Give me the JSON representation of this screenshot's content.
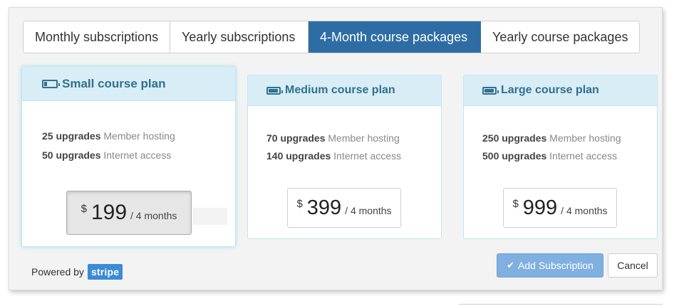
{
  "tabs": [
    {
      "label": "Monthly subscriptions",
      "active": false
    },
    {
      "label": "Yearly subscriptions",
      "active": false
    },
    {
      "label": "4-Month course packages",
      "active": true
    },
    {
      "label": "Yearly course packages",
      "active": false
    }
  ],
  "plans": [
    {
      "name": "Small course plan",
      "selected": true,
      "icon": "battery-low-icon",
      "features": [
        {
          "count": "25 upgrades",
          "label": "Member hosting"
        },
        {
          "count": "50 upgrades",
          "label": "Internet access"
        }
      ],
      "price": {
        "currency": "$",
        "amount": "199",
        "period": "/ 4 months"
      }
    },
    {
      "name": "Medium course plan",
      "selected": false,
      "icon": "battery-icon",
      "features": [
        {
          "count": "70 upgrades",
          "label": "Member hosting"
        },
        {
          "count": "140 upgrades",
          "label": "Internet access"
        }
      ],
      "price": {
        "currency": "$",
        "amount": "399",
        "period": "/ 4 months"
      }
    },
    {
      "name": "Large course plan",
      "selected": false,
      "icon": "battery-full-icon",
      "features": [
        {
          "count": "250 upgrades",
          "label": "Member hosting"
        },
        {
          "count": "500 upgrades",
          "label": "Internet access"
        }
      ],
      "price": {
        "currency": "$",
        "amount": "999",
        "period": "/ 4 months"
      }
    }
  ],
  "footer": {
    "powered_by": "Powered by",
    "stripe_logo": "stripe",
    "add_label": "Add Subscription",
    "cancel_label": "Cancel"
  },
  "colors": {
    "active_tab": "#2e6da4",
    "plan_header_bg": "#d9edf7",
    "plan_header_text": "#31708f",
    "add_button": "#7fb0df",
    "stripe_badge": "#3b8bd6"
  }
}
